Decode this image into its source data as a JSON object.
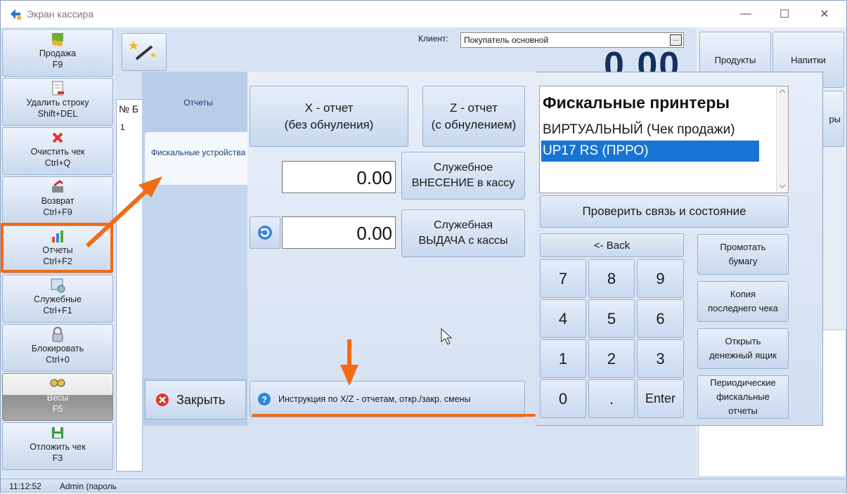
{
  "window": {
    "title": "Экран кассира",
    "minimize": "—",
    "maximize": "☐",
    "close": "✕"
  },
  "sidebar": {
    "items": [
      {
        "label": "Продажа",
        "shortcut": "F9",
        "icon": "coins-icon"
      },
      {
        "label": "Удалить строку",
        "shortcut": "Shift+DEL",
        "icon": "document-delete-icon"
      },
      {
        "label": "Очистить чек",
        "shortcut": "Ctrl+Q",
        "icon": "red-x-icon"
      },
      {
        "label": "Возврат",
        "shortcut": "Ctrl+F9",
        "icon": "return-icon"
      },
      {
        "label": "Отчеты",
        "shortcut": "Ctrl+F2",
        "icon": "chart-icon"
      },
      {
        "label": "Служебные",
        "shortcut": "Ctrl+F1",
        "icon": "settings-icon"
      },
      {
        "label": "Блокировать",
        "shortcut": "Ctrl+0",
        "icon": "lock-icon"
      },
      {
        "label": "Весы",
        "shortcut": "F5",
        "icon": "scales-icon"
      },
      {
        "label": "Отложить чек",
        "shortcut": "F3",
        "icon": "save-icon"
      }
    ]
  },
  "header": {
    "client_label": "Клиент:",
    "client_value": "Покупатель основной",
    "client_button": "...",
    "total": "0.00"
  },
  "table": {
    "header_no": "№",
    "header_b": "Б",
    "row1_no": "1"
  },
  "products": {
    "btn1": "Продукты",
    "btn2": "Напитки",
    "btn3": "ры"
  },
  "dialog": {
    "tabs": {
      "reports": "Отчеты",
      "fiscal": "Фискальные устройства"
    },
    "x_report": {
      "line1": "X - отчет",
      "line2": "(без обнуления)"
    },
    "z_report": {
      "line1": "Z - отчет",
      "line2": "(с обнулением)"
    },
    "deposit_value": "0.00",
    "deposit_btn": {
      "line1": "Служебное",
      "line2": "ВНЕСЕНИЕ в кассу"
    },
    "withdraw_value": "0.00",
    "withdraw_btn": {
      "line1": "Служебная",
      "line2": "ВЫДАЧА с кассы"
    },
    "instruction": "Инструкция по X/Z - отчетам, откр./закр. смены",
    "close": "Закрыть",
    "printers": {
      "title": "Фискальные принтеры",
      "items": [
        "ВИРТУАЛЬНЫЙ (Чек продажи)",
        "UP17 RS (ПРРО)"
      ],
      "selected": 1
    },
    "check_conn": "Проверить связь и состояние",
    "back": "<- Back",
    "keys": [
      "7",
      "8",
      "9",
      "4",
      "5",
      "6",
      "1",
      "2",
      "3",
      "0",
      ".",
      "Enter"
    ],
    "side_buttons": [
      {
        "l1": "Промотать",
        "l2": "бумагу"
      },
      {
        "l1": "Копия",
        "l2": "последнего чека"
      },
      {
        "l1": "Открыть",
        "l2": "денежный ящик"
      },
      {
        "l1": "Периодические",
        "l2": "фискальные",
        "l3": "отчеты"
      }
    ]
  },
  "status": {
    "time": "11:12:52",
    "user": "Admin (пароль"
  },
  "colors": {
    "accent": "#f26b16",
    "selected": "#1874d4",
    "total": "#16305e"
  }
}
